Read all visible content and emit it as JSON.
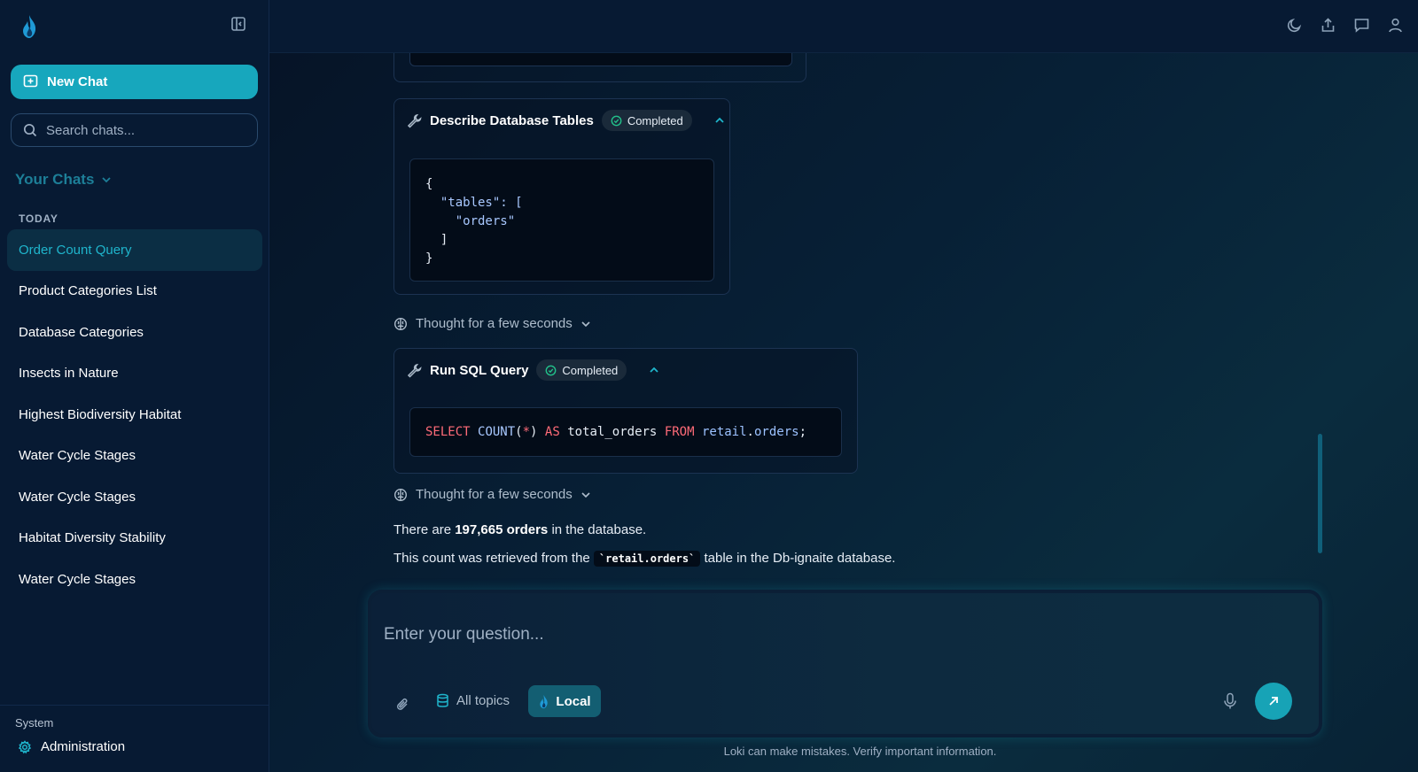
{
  "sidebar": {
    "new_chat_label": "New Chat",
    "search_placeholder": "Search chats...",
    "your_chats_label": "Your Chats",
    "section_today": "TODAY",
    "chats": [
      {
        "label": "Order Count Query",
        "active": true
      },
      {
        "label": "Product Categories List"
      },
      {
        "label": "Database Categories"
      },
      {
        "label": "Insects in Nature"
      },
      {
        "label": "Highest Biodiversity Habitat"
      },
      {
        "label": "Water Cycle Stages"
      },
      {
        "label": "Water Cycle Stages"
      },
      {
        "label": "Habitat Diversity Stability"
      },
      {
        "label": "Water Cycle Stages"
      }
    ],
    "system_label": "System",
    "admin_label": "Administration"
  },
  "conversation": {
    "tool1": {
      "title": "Describe Database Tables",
      "status": "Completed",
      "json_lines": [
        "{",
        "  \"tables\": [",
        "    \"orders\"",
        "  ]",
        "}"
      ]
    },
    "thought1": "Thought for a few seconds",
    "tool2": {
      "title": "Run SQL Query",
      "status": "Completed",
      "sql": "SELECT COUNT(*) AS total_orders FROM retail.orders;"
    },
    "thought2": "Thought for a few seconds",
    "answer1_prefix": "There are ",
    "answer1_bold": "197,665 orders",
    "answer1_suffix": " in the database.",
    "answer2_prefix": "This count was retrieved from the ",
    "answer2_code": "`retail.orders`",
    "answer2_suffix": " table in the Db-ignaite database."
  },
  "composer": {
    "placeholder": "Enter your question...",
    "topics_label": "All topics",
    "local_label": "Local"
  },
  "disclaimer": "Loki can make mistakes. Verify important information.",
  "colors": {
    "accent": "#17a7bd",
    "background": "#061427",
    "sidebar": "#071a33",
    "active_chat_text": "#1fb5cc"
  },
  "icons": [
    "app-logo-icon",
    "collapse-sidebar-icon",
    "new-chat-icon",
    "search-icon",
    "chevron-down-icon",
    "wrench-icon",
    "check-circle-icon",
    "chevron-up-icon",
    "brain-icon",
    "paperclip-icon",
    "database-icon",
    "mic-icon",
    "send-arrow-icon",
    "moon-icon",
    "share-icon",
    "comment-icon",
    "user-icon",
    "gear-icon"
  ]
}
